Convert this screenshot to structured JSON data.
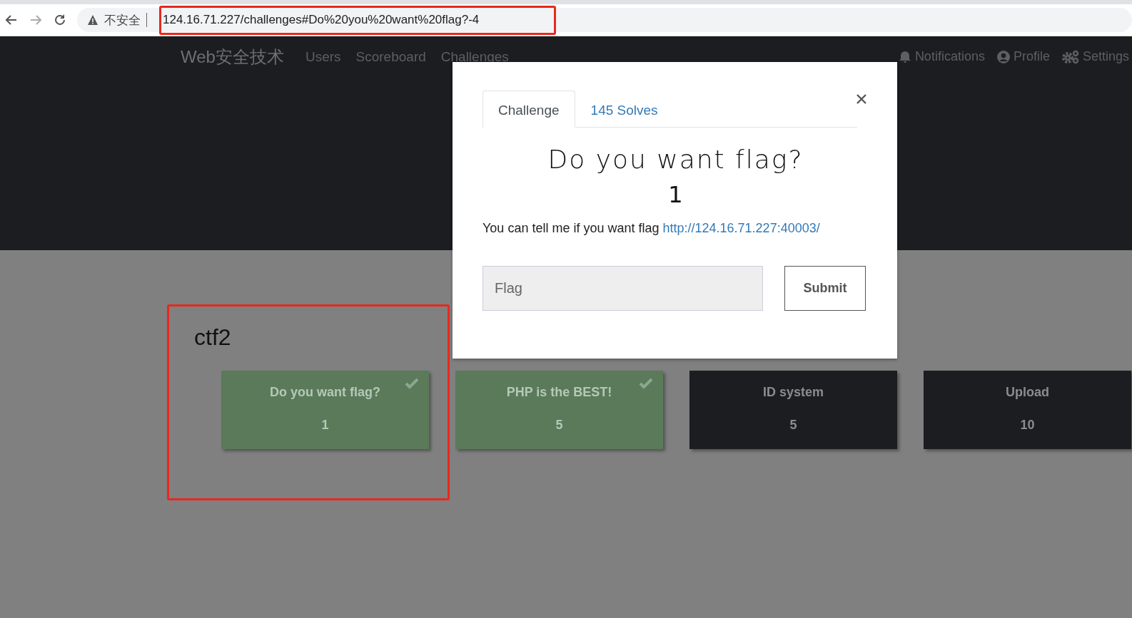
{
  "browser": {
    "security_label": "不安全",
    "url": "124.16.71.227/challenges#Do%20you%20want%20flag?-4"
  },
  "navbar": {
    "brand": "Web安全技术",
    "links": [
      "Users",
      "Scoreboard",
      "Challenges"
    ],
    "right_links": [
      {
        "kind": "bell",
        "label": "Notifications"
      },
      {
        "kind": "user",
        "label": "Profile"
      },
      {
        "kind": "gears",
        "label": "Settings"
      }
    ]
  },
  "category": "ctf2",
  "challenges": [
    {
      "name": "Do you want flag?",
      "value": "1",
      "solved": true
    },
    {
      "name": "PHP is the BEST!",
      "value": "5",
      "solved": true
    },
    {
      "name": "ID system",
      "value": "5",
      "solved": false
    },
    {
      "name": "Upload",
      "value": "10",
      "solved": false
    }
  ],
  "modal": {
    "tabs": [
      {
        "label": "Challenge",
        "selected": true
      },
      {
        "label": "145 Solves",
        "selected": false
      }
    ],
    "title": "Do you want flag?",
    "value": "1",
    "description": "You can tell me if you want flag",
    "link": "http://124.16.71.227:40003/",
    "input": {
      "placeholder": "Flag"
    },
    "submit": "Submit"
  }
}
